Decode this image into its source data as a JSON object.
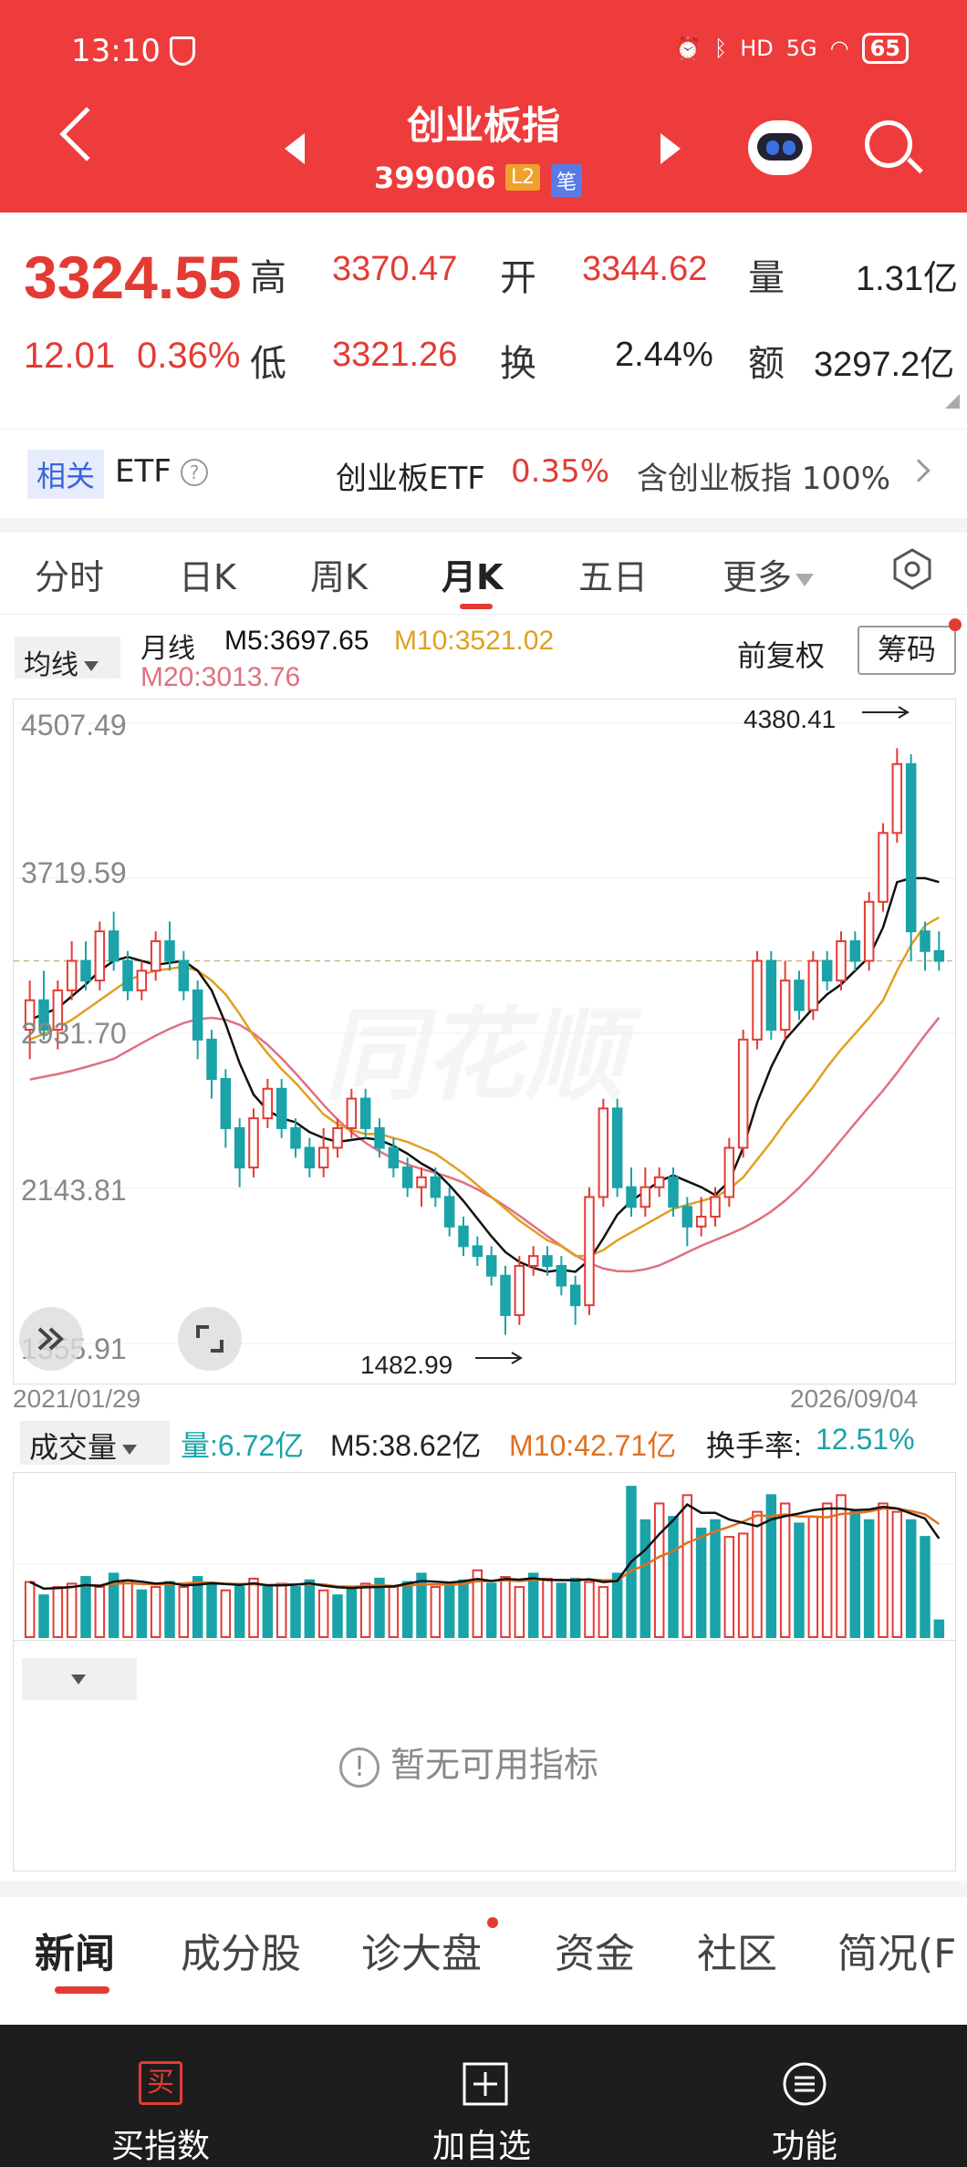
{
  "status": {
    "time": "13:10",
    "net": "HD",
    "signal": "5G",
    "battery": "65"
  },
  "header": {
    "title": "创业板指",
    "code": "399006",
    "tag_l2": "L2",
    "tag_note": "笔"
  },
  "quote": {
    "price": "3324.55",
    "change": "12.01",
    "change_pct": "0.36%",
    "high_label": "高",
    "high": "3370.47",
    "open_label": "开",
    "open": "3344.62",
    "vol_label": "量",
    "vol": "1.31亿",
    "low_label": "低",
    "low": "3321.26",
    "turnover_label": "换",
    "turnover": "2.44%",
    "amount_label": "额",
    "amount": "3297.2亿"
  },
  "etf": {
    "tag": "相关",
    "label": "ETF",
    "name": "创业板ETF",
    "pct": "0.35%",
    "desc": "含创业板指 100%"
  },
  "tabs": [
    "分时",
    "日K",
    "周K",
    "月K",
    "五日",
    "更多"
  ],
  "ma": {
    "btn": "均线",
    "line": "月线",
    "m5": "M5:3697.65",
    "m10": "M10:3521.02",
    "m20": "M20:3013.76",
    "fq": "前复权",
    "chouma": "筹码"
  },
  "axis": {
    "y1": "4507.49",
    "y2": "3719.59",
    "y3": "2931.70",
    "y4": "2143.81",
    "y5": "1355.91",
    "start": "2021/01/29",
    "end": "2026/09/04"
  },
  "peaks": {
    "high": "4380.41",
    "low": "1482.99"
  },
  "watermark": "同花顺",
  "volume": {
    "btn": "成交量",
    "vol": "量:6.72亿",
    "m5": "M5:38.62亿",
    "m10": "M10:42.71亿",
    "turn_label": "换手率:",
    "turn": "12.51%"
  },
  "indicator": {
    "empty": "暂无可用指标"
  },
  "news_tabs": [
    "新闻",
    "成分股",
    "诊大盘",
    "资金",
    "社区",
    "简况(F"
  ],
  "bottom": {
    "buy": "买指数",
    "buy_icon": "买",
    "add": "加自选",
    "func": "功能"
  },
  "colors": {
    "up": "#e33b34",
    "down": "#1aa3a8",
    "m5": "#111111",
    "m10": "#e0a020",
    "m20": "#e07080"
  },
  "chart_data": {
    "type": "candlestick",
    "x_range": [
      "2021/01/29",
      "2026/09/04"
    ],
    "y_ticks": [
      4507.49,
      3719.59,
      2931.7,
      2143.81,
      1355.91
    ],
    "ylim": [
      1355.91,
      4507.49
    ],
    "candles": [
      [
        2950,
        3100,
        2800,
        3200
      ],
      [
        3100,
        2950,
        2900,
        3250
      ],
      [
        2950,
        3150,
        2850,
        3200
      ],
      [
        3150,
        3300,
        3100,
        3400
      ],
      [
        3300,
        3200,
        3150,
        3400
      ],
      [
        3200,
        3450,
        3150,
        3500
      ],
      [
        3450,
        3300,
        3250,
        3550
      ],
      [
        3300,
        3150,
        3100,
        3350
      ],
      [
        3150,
        3250,
        3100,
        3300
      ],
      [
        3250,
        3400,
        3200,
        3450
      ],
      [
        3400,
        3300,
        3250,
        3500
      ],
      [
        3300,
        3150,
        3100,
        3350
      ],
      [
        3150,
        2900,
        2800,
        3200
      ],
      [
        2900,
        2700,
        2600,
        2950
      ],
      [
        2700,
        2450,
        2350,
        2750
      ],
      [
        2450,
        2250,
        2150,
        2500
      ],
      [
        2250,
        2500,
        2200,
        2550
      ],
      [
        2500,
        2650,
        2450,
        2700
      ],
      [
        2650,
        2450,
        2400,
        2700
      ],
      [
        2450,
        2350,
        2300,
        2500
      ],
      [
        2350,
        2250,
        2200,
        2400
      ],
      [
        2250,
        2350,
        2200,
        2450
      ],
      [
        2350,
        2450,
        2300,
        2500
      ],
      [
        2450,
        2600,
        2400,
        2650
      ],
      [
        2600,
        2450,
        2400,
        2650
      ],
      [
        2450,
        2350,
        2300,
        2500
      ],
      [
        2350,
        2250,
        2200,
        2400
      ],
      [
        2250,
        2150,
        2100,
        2300
      ],
      [
        2150,
        2200,
        2050,
        2250
      ],
      [
        2200,
        2100,
        2050,
        2250
      ],
      [
        2100,
        1950,
        1900,
        2150
      ],
      [
        1950,
        1850,
        1800,
        2000
      ],
      [
        1850,
        1800,
        1750,
        1900
      ],
      [
        1800,
        1700,
        1650,
        1850
      ],
      [
        1700,
        1500,
        1400,
        1750
      ],
      [
        1500,
        1750,
        1450,
        1800
      ],
      [
        1750,
        1800,
        1700,
        1850
      ],
      [
        1800,
        1750,
        1700,
        1850
      ],
      [
        1750,
        1650,
        1600,
        1800
      ],
      [
        1650,
        1550,
        1450,
        1700
      ],
      [
        1550,
        2100,
        1500,
        2150
      ],
      [
        2100,
        2550,
        2050,
        2600
      ],
      [
        2550,
        2150,
        2100,
        2600
      ],
      [
        2150,
        2050,
        2000,
        2250
      ],
      [
        2050,
        2150,
        2000,
        2250
      ],
      [
        2150,
        2200,
        2100,
        2250
      ],
      [
        2200,
        2050,
        2000,
        2250
      ],
      [
        2050,
        1950,
        1850,
        2100
      ],
      [
        1950,
        2000,
        1900,
        2100
      ],
      [
        2000,
        2100,
        1950,
        2150
      ],
      [
        2100,
        2350,
        2050,
        2400
      ],
      [
        2350,
        2900,
        2300,
        2950
      ],
      [
        2900,
        3300,
        2850,
        3350
      ],
      [
        3300,
        2950,
        2900,
        3350
      ],
      [
        2950,
        3200,
        2900,
        3300
      ],
      [
        3200,
        3050,
        3000,
        3250
      ],
      [
        3050,
        3300,
        3000,
        3350
      ],
      [
        3300,
        3200,
        3150,
        3350
      ],
      [
        3200,
        3400,
        3150,
        3450
      ],
      [
        3400,
        3300,
        3250,
        3450
      ],
      [
        3300,
        3600,
        3250,
        3650
      ],
      [
        3600,
        3950,
        3550,
        4000
      ],
      [
        3950,
        4300,
        3900,
        4380.41
      ],
      [
        4300,
        3450,
        3300,
        4350
      ],
      [
        3450,
        3350,
        3250,
        3500
      ],
      [
        3350,
        3300,
        3250,
        3450
      ]
    ],
    "ma5": [
      3000,
      3030,
      3060,
      3120,
      3180,
      3250,
      3300,
      3320,
      3300,
      3280,
      3290,
      3300,
      3250,
      3150,
      2980,
      2780,
      2620,
      2540,
      2500,
      2480,
      2430,
      2400,
      2380,
      2390,
      2400,
      2390,
      2360,
      2320,
      2270,
      2230,
      2160,
      2080,
      1990,
      1900,
      1820,
      1770,
      1740,
      1720,
      1730,
      1720,
      1780,
      1890,
      2010,
      2080,
      2130,
      2180,
      2210,
      2180,
      2150,
      2110,
      2180,
      2350,
      2580,
      2760,
      2900,
      2980,
      3060,
      3130,
      3180,
      3250,
      3320,
      3470,
      3700,
      3720,
      3720,
      3700
    ],
    "ma10": [
      2900,
      2930,
      2960,
      3000,
      3050,
      3100,
      3150,
      3200,
      3230,
      3250,
      3260,
      3270,
      3250,
      3200,
      3130,
      3030,
      2920,
      2830,
      2750,
      2680,
      2600,
      2520,
      2470,
      2440,
      2420,
      2420,
      2400,
      2380,
      2350,
      2320,
      2270,
      2220,
      2160,
      2100,
      2040,
      1980,
      1930,
      1880,
      1850,
      1800,
      1800,
      1830,
      1880,
      1920,
      1960,
      2000,
      2040,
      2060,
      2080,
      2100,
      2140,
      2200,
      2290,
      2380,
      2480,
      2570,
      2660,
      2760,
      2850,
      2930,
      3010,
      3100,
      3250,
      3380,
      3480,
      3521
    ]
  },
  "volume_data": {
    "values": [
      33,
      25,
      30,
      32,
      36,
      30,
      38,
      34,
      28,
      30,
      33,
      30,
      36,
      32,
      28,
      30,
      35,
      30,
      32,
      30,
      34,
      28,
      25,
      30,
      32,
      35,
      30,
      33,
      38,
      30,
      32,
      34,
      40,
      32,
      36,
      30,
      38,
      35,
      32,
      35,
      33,
      30,
      38,
      90,
      70,
      80,
      72,
      85,
      65,
      70,
      60,
      62,
      75,
      85,
      80,
      68,
      72,
      80,
      85,
      75,
      70,
      80,
      75,
      70,
      60,
      10
    ],
    "dir": [
      1,
      -1,
      1,
      1,
      -1,
      1,
      -1,
      1,
      -1,
      1,
      -1,
      1,
      -1,
      -1,
      1,
      -1,
      1,
      -1,
      1,
      -1,
      -1,
      1,
      -1,
      -1,
      1,
      -1,
      1,
      -1,
      -1,
      1,
      -1,
      -1,
      1,
      -1,
      1,
      1,
      -1,
      1,
      -1,
      -1,
      1,
      1,
      -1,
      -1,
      -1,
      1,
      -1,
      1,
      -1,
      -1,
      1,
      1,
      1,
      -1,
      1,
      -1,
      1,
      1,
      1,
      -1,
      -1,
      1,
      1,
      -1,
      -1,
      -1
    ]
  }
}
